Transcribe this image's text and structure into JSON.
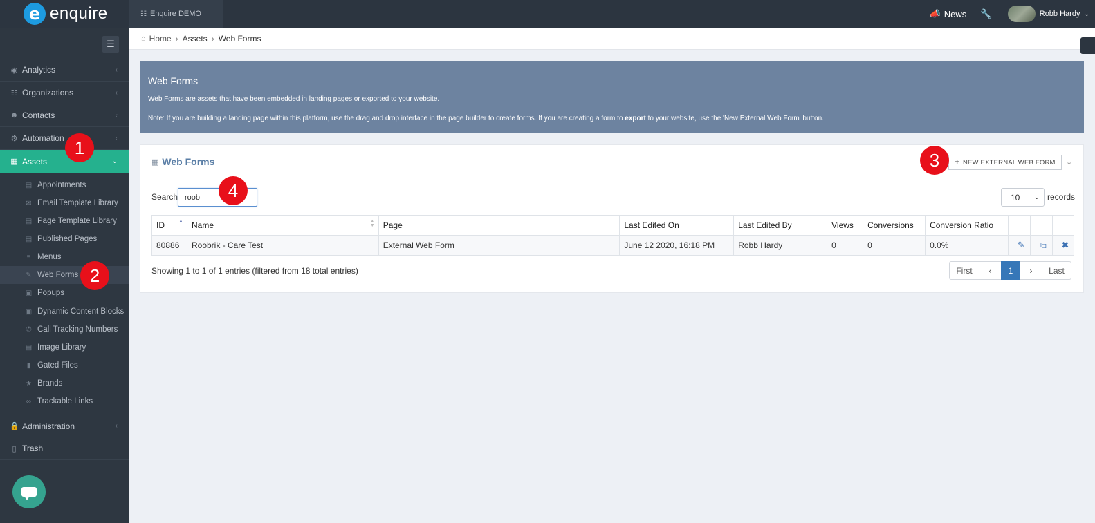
{
  "brand": {
    "logo_letter": "e",
    "name": "enquire"
  },
  "topbar": {
    "org_name": "Enquire DEMO",
    "news_label": "News",
    "user_name": "Robb Hardy"
  },
  "sidebar": {
    "items": [
      {
        "label": "Analytics",
        "icon": "chart-icon"
      },
      {
        "label": "Organizations",
        "icon": "sitemap-icon"
      },
      {
        "label": "Contacts",
        "icon": "users-icon"
      },
      {
        "label": "Automation",
        "icon": "cogs-icon"
      },
      {
        "label": "Assets",
        "icon": "grid-icon"
      }
    ],
    "sub_items": [
      {
        "label": "Appointments"
      },
      {
        "label": "Email Template Library"
      },
      {
        "label": "Page Template Library"
      },
      {
        "label": "Published Pages"
      },
      {
        "label": "Menus"
      },
      {
        "label": "Web Forms"
      },
      {
        "label": "Popups"
      },
      {
        "label": "Dynamic Content Blocks"
      },
      {
        "label": "Call Tracking Numbers"
      },
      {
        "label": "Image Library"
      },
      {
        "label": "Gated Files"
      },
      {
        "label": "Brands"
      },
      {
        "label": "Trackable Links"
      }
    ],
    "bottom_items": [
      {
        "label": "Administration"
      },
      {
        "label": "Trash"
      }
    ]
  },
  "breadcrumb": {
    "home": "Home",
    "assets": "Assets",
    "current": "Web Forms"
  },
  "banner": {
    "title": "Web Forms",
    "line1": "Web Forms are assets that have been embedded in landing pages or exported to your website.",
    "line2_a": "Note: If you are building a landing page within this platform, use the drag and drop interface in the page builder to create forms. If you are creating a form to ",
    "line2_b": "export",
    "line2_c": " to your website, use the 'New External Web Form' button."
  },
  "panel": {
    "title": "Web Forms",
    "new_button": "NEW EXTERNAL WEB FORM",
    "search_label": "Search:",
    "search_value": "roob",
    "page_size": "10",
    "records_label": "records",
    "columns": [
      "ID",
      "Name",
      "Page",
      "Last Edited On",
      "Last Edited By",
      "Views",
      "Conversions",
      "Conversion Ratio"
    ],
    "row": {
      "id": "80886",
      "name": "Roobrik - Care Test",
      "page": "External Web Form",
      "last_edited_on": "June 12 2020, 16:18 PM",
      "last_edited_by": "Robb Hardy",
      "views": "0",
      "conversions": "0",
      "conversion_ratio": "0.0%"
    },
    "showing": "Showing 1 to 1 of 1 entries (filtered from 18 total entries)",
    "pager": {
      "first": "First",
      "prev": "‹",
      "current": "1",
      "next": "›",
      "last": "Last"
    }
  },
  "markers": [
    "1",
    "2",
    "3",
    "4"
  ],
  "colors": {
    "accent": "#25b18e",
    "banner": "#6d83a0",
    "marker": "#e8101a",
    "link": "#3677b8"
  }
}
